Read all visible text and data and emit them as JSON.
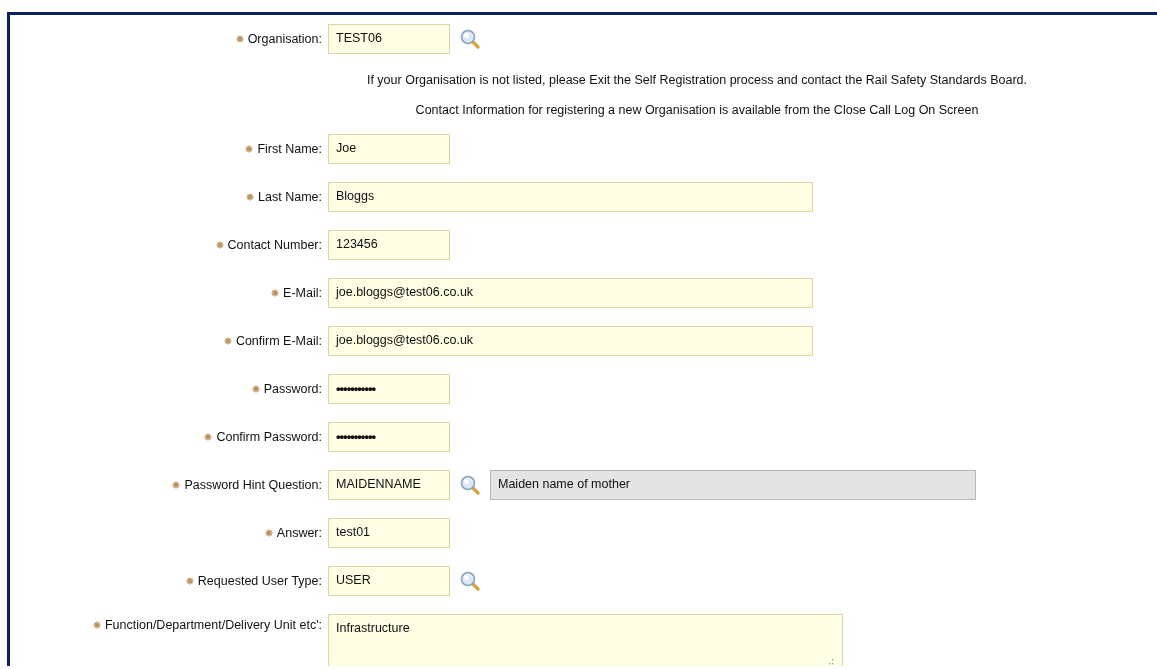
{
  "fields": [
    {
      "label": "Organisation:",
      "required": true,
      "kind": "text",
      "wide": false,
      "value": "TEST06",
      "lookup": true
    },
    {
      "kind": "note",
      "lines": [
        "If your Organisation is not listed, please Exit the Self Registration process and contact the Rail Safety Standards Board.",
        "Contact Information for registering a new Organisation is available from the Close Call Log On Screen"
      ]
    },
    {
      "label": "First Name:",
      "required": true,
      "kind": "text",
      "wide": false,
      "value": "Joe",
      "lookup": false
    },
    {
      "label": "Last Name:",
      "required": true,
      "kind": "text",
      "wide": true,
      "value": "Bloggs",
      "lookup": false
    },
    {
      "label": "Contact Number:",
      "required": true,
      "kind": "text",
      "wide": false,
      "value": "123456",
      "lookup": false
    },
    {
      "label": "E-Mail:",
      "required": true,
      "kind": "text",
      "wide": true,
      "value": "joe.bloggs@test06.co.uk",
      "lookup": false
    },
    {
      "label": "Confirm E-Mail:",
      "required": true,
      "kind": "text",
      "wide": true,
      "value": "joe.bloggs@test06.co.uk",
      "lookup": false
    },
    {
      "label": "Password:",
      "required": true,
      "kind": "password",
      "wide": false,
      "value": "•••••••••••",
      "lookup": false
    },
    {
      "label": "Confirm Password:",
      "required": true,
      "kind": "password",
      "wide": false,
      "value": "•••••••••••",
      "lookup": false
    },
    {
      "label": "Password Hint Question:",
      "required": true,
      "kind": "text",
      "wide": false,
      "value": "MAIDENNAME",
      "lookup": true,
      "description": "Maiden name of mother"
    },
    {
      "label": "Answer:",
      "required": true,
      "kind": "text",
      "wide": false,
      "value": "test01",
      "lookup": false
    },
    {
      "label": "Requested User Type:",
      "required": true,
      "kind": "text",
      "wide": false,
      "value": "USER",
      "lookup": true
    },
    {
      "label": "Function/Department/Delivery Unit etc':",
      "required": true,
      "kind": "textarea",
      "wide": true,
      "value": "Infrastructure",
      "lookup": false
    }
  ]
}
